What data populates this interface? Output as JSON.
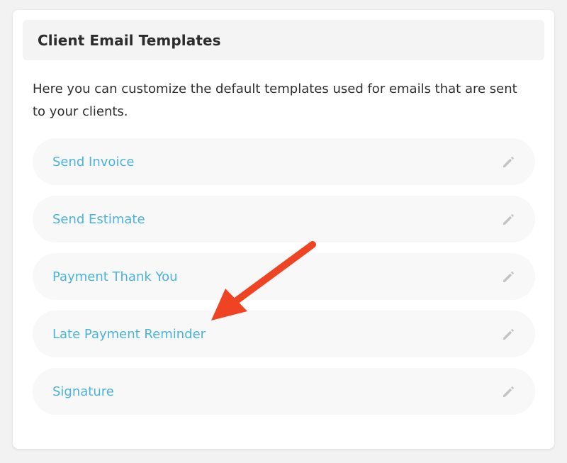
{
  "panel": {
    "title": "Client Email Templates",
    "description": "Here you can customize the default templates used for emails that are sent to your clients."
  },
  "templates": [
    {
      "label": "Send Invoice",
      "icon": "pencil-icon"
    },
    {
      "label": "Send Estimate",
      "icon": "pencil-icon"
    },
    {
      "label": "Payment Thank You",
      "icon": "pencil-icon"
    },
    {
      "label": "Late Payment Reminder",
      "icon": "pencil-icon"
    },
    {
      "label": "Signature",
      "icon": "pencil-icon"
    }
  ],
  "colors": {
    "link": "#4ab4dc",
    "icon": "#c4c4c4",
    "annotation_arrow": "#ee4423"
  }
}
